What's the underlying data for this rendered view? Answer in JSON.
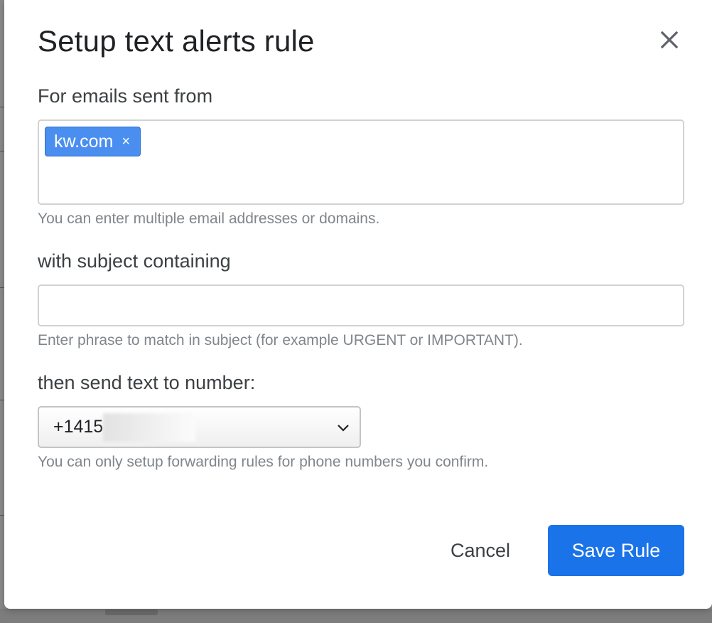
{
  "dialog": {
    "title": "Setup text alerts rule",
    "close_icon": "close-icon"
  },
  "from_section": {
    "label": "For emails sent from",
    "chips": [
      {
        "label": "kw.com",
        "remove_glyph": "×"
      }
    ],
    "hint": "You can enter multiple email addresses or domains."
  },
  "subject_section": {
    "label": "with subject containing",
    "value": "",
    "hint": "Enter phrase to match in subject (for example URGENT or IMPORTANT)."
  },
  "number_section": {
    "label": "then send text to number:",
    "selected_value": "+1415",
    "hint": "You can only setup forwarding rules for phone numbers you confirm.",
    "dropdown_icon": "chevron-down-icon"
  },
  "actions": {
    "cancel_label": "Cancel",
    "save_label": "Save Rule"
  },
  "colors": {
    "primary": "#1a73e8",
    "chip": "#4a8ef0"
  }
}
